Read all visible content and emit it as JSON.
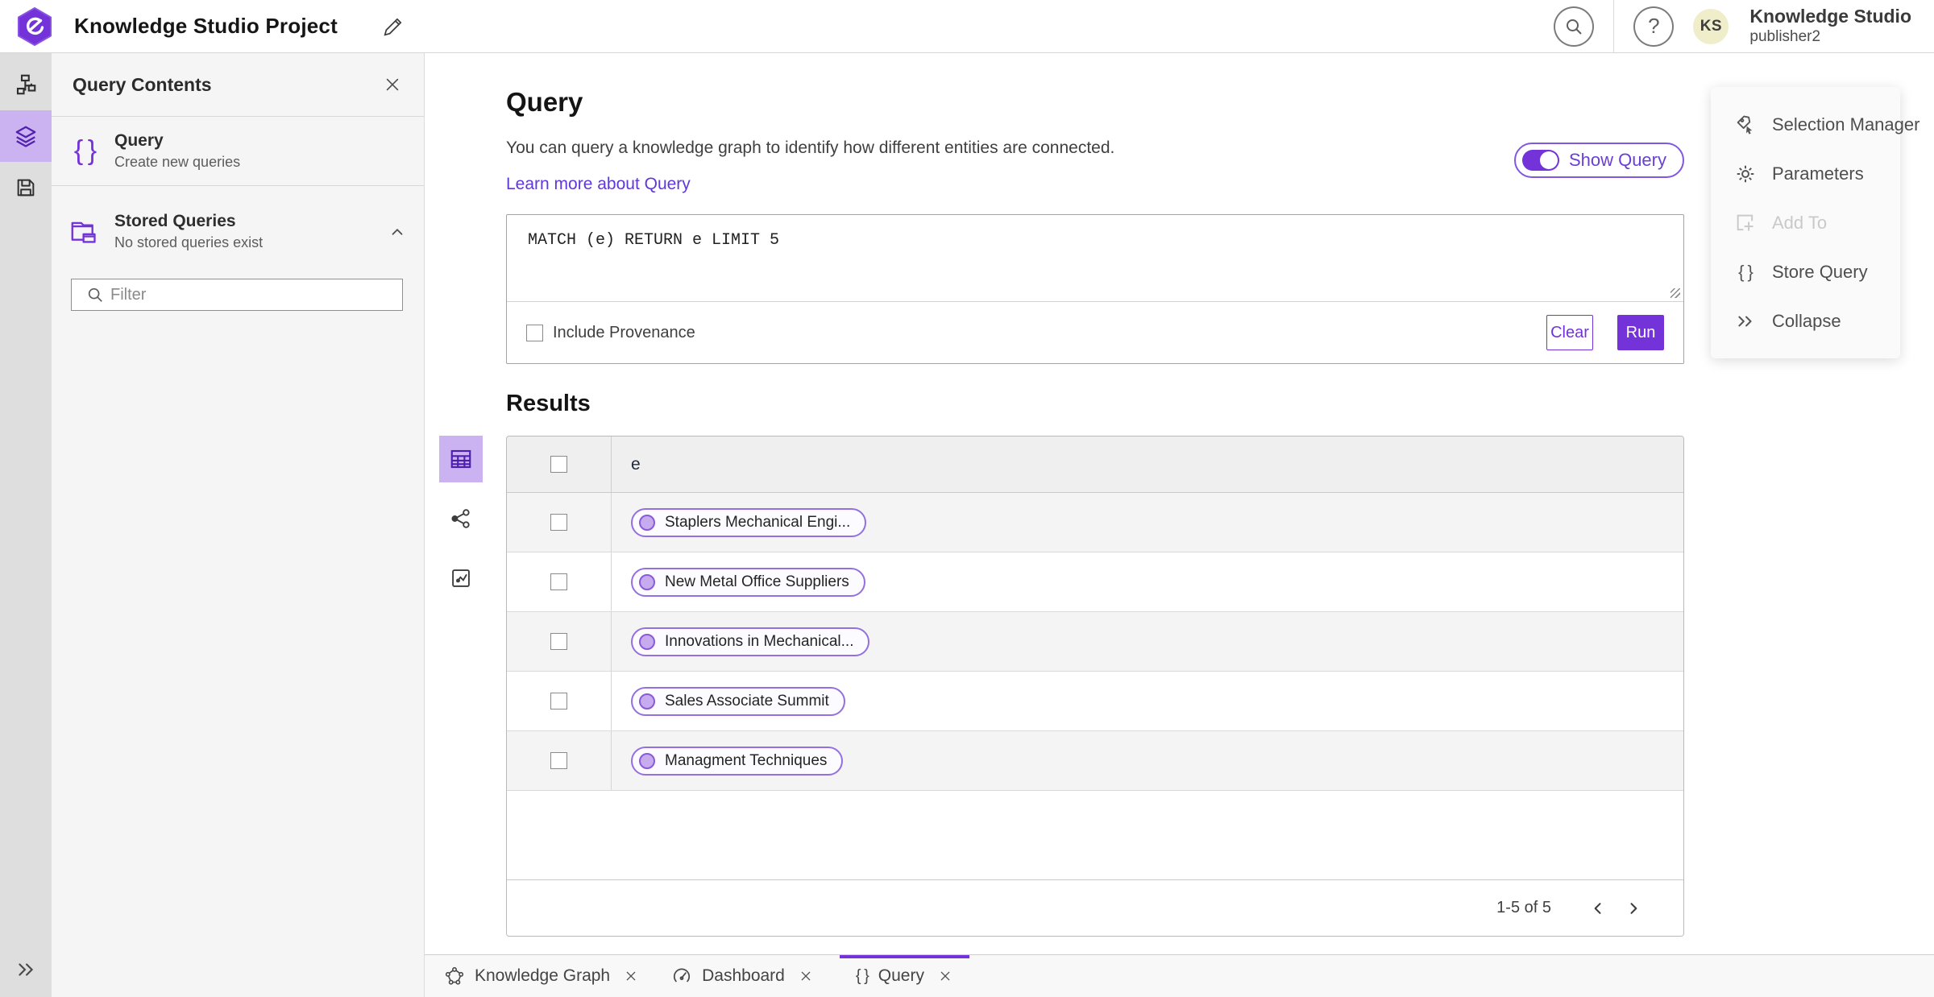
{
  "header": {
    "title": "Knowledge Studio Project",
    "user": {
      "initials": "KS",
      "name": "Knowledge Studio",
      "role": "publisher2"
    }
  },
  "left_panel": {
    "title": "Query Contents",
    "items": [
      {
        "title": "Query",
        "subtitle": "Create new queries"
      },
      {
        "title": "Stored Queries",
        "subtitle": "No stored queries exist"
      }
    ],
    "filter_placeholder": "Filter"
  },
  "query": {
    "heading": "Query",
    "description": "You can query a knowledge graph to identify how different entities are connected.",
    "learn_more": "Learn more about Query",
    "show_query_label": "Show Query",
    "query_text": "MATCH (e) RETURN e LIMIT 5",
    "include_provenance_label": "Include Provenance",
    "clear_label": "Clear",
    "run_label": "Run"
  },
  "results": {
    "heading": "Results",
    "column_header": "e",
    "rows": [
      "Staplers Mechanical Engi...",
      "New Metal Office Suppliers",
      "Innovations in Mechanical...",
      "Sales Associate Summit",
      "Managment Techniques"
    ],
    "pagination": {
      "label": "1-5 of 5"
    }
  },
  "right_panel": {
    "items": [
      {
        "label": "Selection Manager"
      },
      {
        "label": "Parameters"
      },
      {
        "label": "Add To"
      },
      {
        "label": "Store Query"
      },
      {
        "label": "Collapse"
      }
    ]
  },
  "tabs": [
    {
      "label": "Knowledge Graph"
    },
    {
      "label": "Dashboard"
    },
    {
      "label": "Query"
    }
  ],
  "glyphs": {
    "braces": "{ }",
    "help": "?"
  },
  "colors": {
    "accent": "#7433d8",
    "accent_light": "#cbb3f1",
    "link": "#6138d8",
    "chip_border": "#9470de",
    "chip_dot": "#c6abef",
    "chip_dot_border": "#8a5ad8",
    "avatar_bg": "#efedca"
  }
}
